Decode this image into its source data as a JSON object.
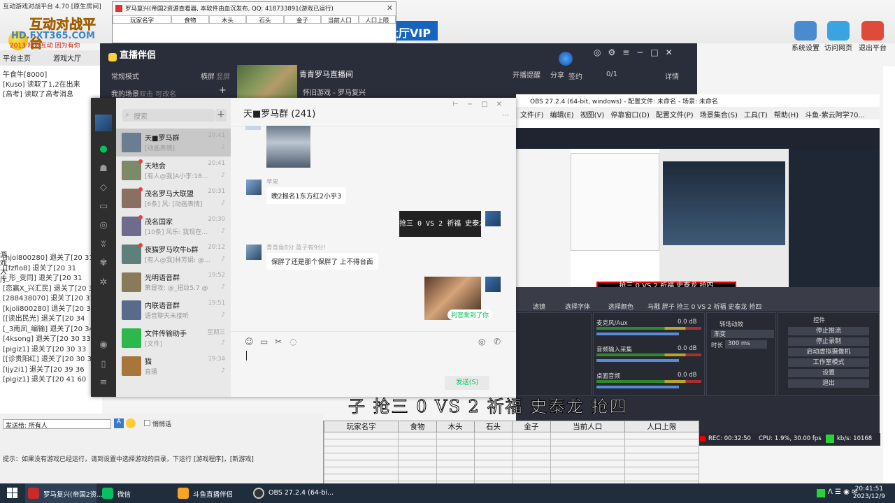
{
  "lobby": {
    "title": "互动游戏对战平台 4.70 [原生房间]",
    "logo_big": "互动对战平台",
    "logo_url": "HD.FXT365.COM",
    "logo_slogan": "2013 精彩互动 因为有你",
    "tabs": [
      "平台主页",
      "游戏大厅"
    ],
    "vip": "大厅VIP",
    "tools": [
      "系统设置",
      "访问网页",
      "退出平台"
    ],
    "left_lines": [
      "午食牛[8000]",
      "[Kuso] 读取了1,2在出来",
      "[高考] 读取了高考消息"
    ],
    "log_lines": [
      "[hjol800280] 退关了[20 31",
      "[[fzflo8] 退关了[20 31",
      "[_形_变同] 退关了[20 31",
      "[恋赢X_兴汇民] 退关了[20 31",
      "[288438070] 退关了[20 31",
      "[kjoli800280] 退关了[20 34",
      "[[读出民光] 退关了[20 34",
      "[_3南凤_编输] 退关了[20 34",
      "[4ksong] 退关了[20 30 33",
      "[pigiz1] 退关了[20 30 33",
      "[[诊贵阳红] 退关了[20 30 33",
      "[Ijy2i1] 退关了[20 39 36",
      "[pigiz1] 退关了[20 41 60"
    ],
    "send_label": "发送给: 所有人",
    "private_label": "悄悄话",
    "tip": "提示：如果没有游戏已经运行，请到设置中选择游戏的目录，下运行 [游戏程序]，[新游戏]",
    "vertical_text": "游戏大厅"
  },
  "floating_table": {
    "title": "罗马复兴(帝国2资源查看器, 本软件由血沉发布, QQ: 418733891(游戏已运行)",
    "columns": [
      "玩家名字",
      "食物",
      "木头",
      "石头",
      "金子",
      "当前人口",
      "人口上限"
    ]
  },
  "zhibo": {
    "title": "直播伴侣",
    "mode": "常规模式",
    "layout_h": "横屏",
    "layout_v": "竖屏",
    "scenes_label": "我的场景",
    "scenes_actions": "双击 可改名",
    "room_title": "青青罗马直播间",
    "category": "怀旧游戏 - 罗马复兴",
    "open_live": "开播提醒",
    "share": "分享",
    "sign_in": "签约",
    "counter": "0/1",
    "details": "详情"
  },
  "chat": {
    "title": "天■罗马群 (241)",
    "search_placeholder": "搜索",
    "send_button": "发送(S)",
    "chat_list": [
      {
        "name": "天■罗马群",
        "time": "20:41",
        "sub": "[动画表情]",
        "selected": true
      },
      {
        "name": "天地会",
        "time": "20:41",
        "sub": "[有人@我]A小李:1826727..."
      },
      {
        "name": "茂名罗马大联盟",
        "time": "20:31",
        "sub": "[6条] 风: [动画表情]"
      },
      {
        "name": "茂名国家",
        "time": "20:30",
        "sub": "[10条] 风乐: 我现在国州..."
      },
      {
        "name": "夜猫罗马吹牛b群",
        "time": "20:12",
        "sub": "[有人@我]林芳娟: @茶..."
      },
      {
        "name": "光明语音群",
        "time": "19:52",
        "sub": "策督攻: @_扭纹5.7 @"
      },
      {
        "name": "内联语音群",
        "time": "19:51",
        "sub": "语音聊天未接听"
      },
      {
        "name": "文件传输助手",
        "time": "星期三",
        "sub": "[文件]"
      },
      {
        "name": "猫",
        "time": "19:34",
        "sub": "直播"
      }
    ],
    "messages": [
      {
        "from": "苹果",
        "text": "晚2报名1东方红2小乎3"
      },
      {
        "from": "me",
        "text": "抢三 0 VS 2 祈福 史泰龙"
      },
      {
        "from": "青青鱼8分 苗子有9分!",
        "text": "保胖了还是那个保胖了 上不得台面"
      },
      {
        "from": "me",
        "text": "判官爱到了你"
      }
    ]
  },
  "obs": {
    "menu": [
      "文件(F)",
      "编辑(E)",
      "视图(V)",
      "停靠窗口(D)",
      "配置文件(P)",
      "场景集合(S)",
      "工具(T)",
      "帮助(H)",
      "斗鱼-紫云阿学70..."
    ],
    "title": "OBS 27.2.4 (64-bit, windows) - 配置文件: 未命名 - 场景: 未命名",
    "caption": "抢三 0 VS 2 祈福 史泰龙 抢四",
    "toolbar": [
      "滤镜",
      "选择字体",
      "选择颜色",
      "马戳 胖子 抢三 0 VS 2 祈福 史泰龙 抢四"
    ],
    "mixer": [
      {
        "name": "麦克风/Aux",
        "db": "0.0 dB"
      },
      {
        "name": "音频输入采集",
        "db": "0.0 dB"
      },
      {
        "name": "桌面音频",
        "db": "0.0 dB"
      }
    ],
    "transition_label": "转场动效",
    "transition_value": "渐变",
    "duration_label": "时长",
    "duration_value": "300 ms",
    "controls_label": "控件",
    "buttons": [
      "停止推流",
      "停止录制",
      "启动虚拟摄像机",
      "工作室模式",
      "设置",
      "退出"
    ],
    "status": {
      "rec": "REC: 00:32:50",
      "cpu": "CPU: 1.9%, 30.00 fps",
      "kbs": "kb/s: 10168"
    }
  },
  "big_subtitle": "子 抢三 0 VS 2 祈福 史泰龙 抢四",
  "resource_table": {
    "columns": [
      "玩家名字",
      "食物",
      "木头",
      "石头",
      "金子",
      "当前人口",
      "人口上限"
    ]
  },
  "taskbar": {
    "items": [
      "罗马复兴(帝国2资...",
      "微信",
      "斗鱼直播伴侣",
      "OBS 27.2.4 (64-bi..."
    ],
    "time": "20:41:51",
    "date": "2023/12/9"
  },
  "colors": {
    "wechat_green": "#07c160",
    "obs_bg": "#2b2e38",
    "taskbar": "#1f2d3c"
  }
}
